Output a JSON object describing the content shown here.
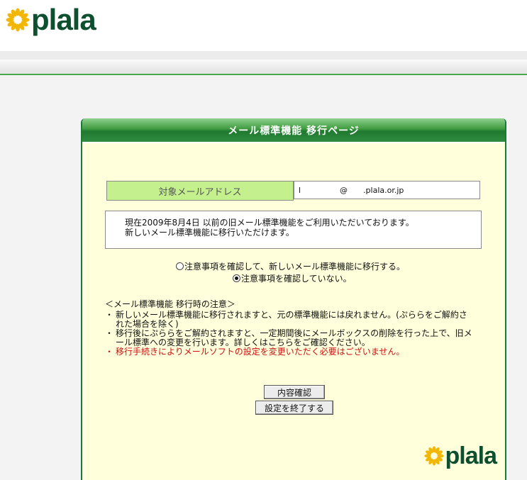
{
  "brand": {
    "name": "plala"
  },
  "panel": {
    "title": "メール標準機能 移行ページ",
    "address_label": "対象メールアドレス",
    "address_value": "l　　　　　@　　.plala.or.jp",
    "status_lines": [
      "現在2009年8月4日 以前の旧メール標準機能をご利用いただいております。",
      "新しいメール標準機能に移行いただけます。"
    ]
  },
  "options": {
    "migrate": {
      "label": "注意事項を確認して、新しいメール標準機能に移行する。",
      "checked": false
    },
    "not_confirmed": {
      "label": "注意事項を確認していない。",
      "checked": true
    }
  },
  "notes": {
    "heading": "＜メール標準機能 移行時の注意＞",
    "items": [
      {
        "bullet": "・",
        "text": "新しいメール標準機能に移行されますと、元の標準機能には戻れません。(ぷららをご解約された場合を除く)"
      },
      {
        "bullet": "・",
        "text": "移行後にぷららをご解約されますと、一定期間後にメールボックスの削除を行った上で、旧メール標準への変更を行います。詳しくはこちらをご確認ください。"
      },
      {
        "bullet": "・",
        "text": "移行手続きによりメールソフトの設定を変更いただく必要はございません。"
      }
    ]
  },
  "buttons": {
    "confirm": "内容確認",
    "finish": "設定を終了する"
  },
  "colors": {
    "brand_green": "#0d4f2e",
    "header_green": "#3f9b3f",
    "label_green": "#c4f08e",
    "panel_bg": "#ffffdc",
    "warning_red": "#cc1010"
  }
}
